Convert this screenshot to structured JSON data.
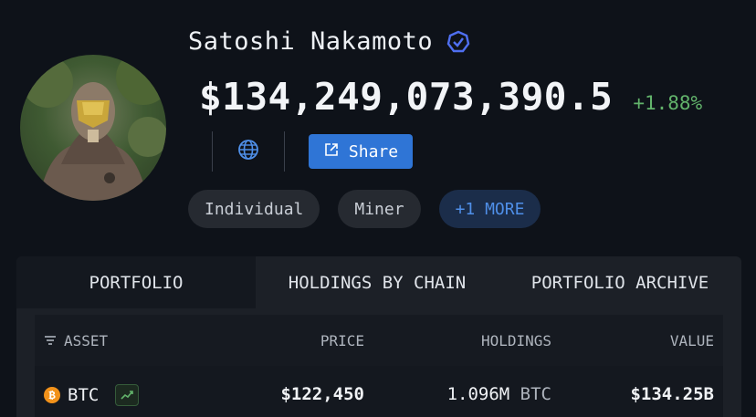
{
  "profile": {
    "name": "Satoshi Nakamoto",
    "total_value": "$134,249,073,390.5",
    "change": "+1.88%"
  },
  "actions": {
    "share_label": "Share"
  },
  "tags": [
    "Individual",
    "Miner",
    "+1 MORE"
  ],
  "tabs": [
    "PORTFOLIO",
    "HOLDINGS BY CHAIN",
    "PORTFOLIO ARCHIVE"
  ],
  "table": {
    "headers": {
      "asset": "ASSET",
      "price": "PRICE",
      "holdings": "HOLDINGS",
      "value": "VALUE"
    },
    "rows": [
      {
        "asset": "BTC",
        "price": "$122,450",
        "holdings": "1.096M",
        "holdings_unit": "BTC",
        "value": "$134.25B"
      }
    ]
  },
  "colors": {
    "accent": "#2f75d6",
    "positive": "#62b36b",
    "btc": "#f2921a"
  },
  "icons": [
    "verified-badge-icon",
    "globe-icon",
    "share-external-icon",
    "filter-icon",
    "bitcoin-icon",
    "trend-chart-icon"
  ]
}
